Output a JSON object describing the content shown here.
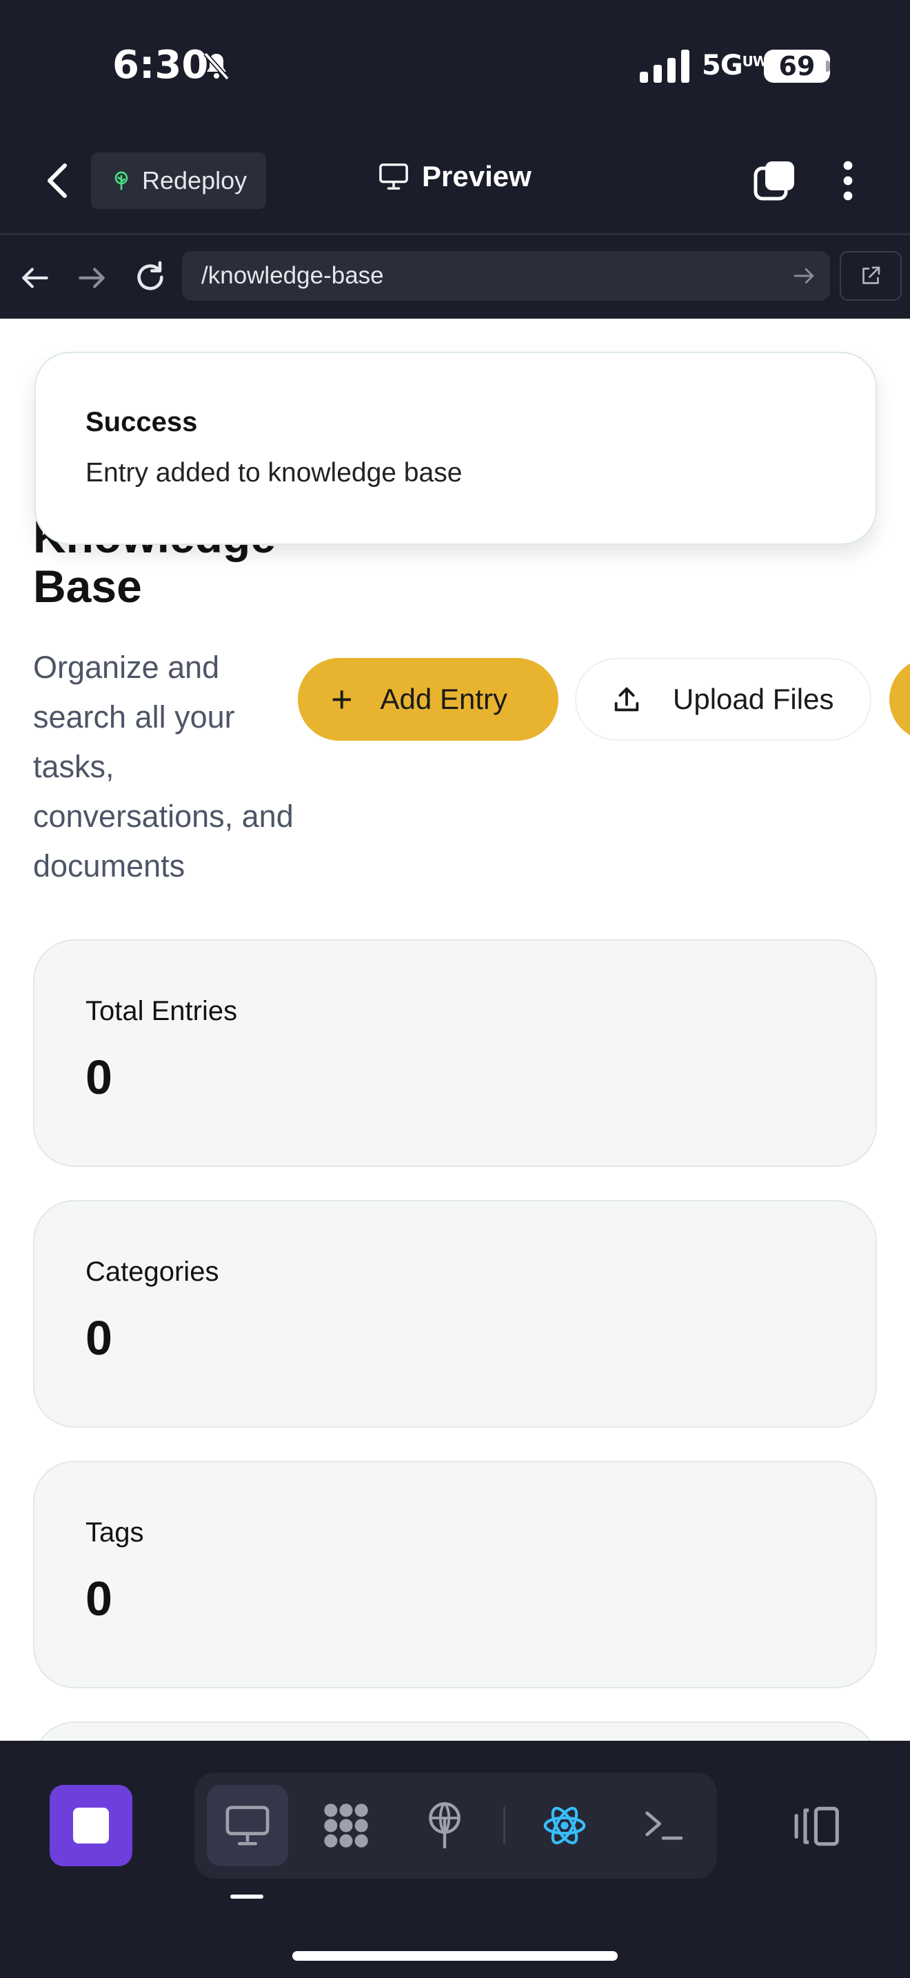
{
  "status_bar": {
    "time": "6:30",
    "network": "5G",
    "network_sup": "UW",
    "battery": "69",
    "icons": [
      "bell-slash-icon",
      "signal-bars-icon"
    ]
  },
  "app_bar": {
    "back_icon": "chevron-left-icon",
    "redeploy_label": "Redeploy",
    "redeploy_icon": "tree-icon",
    "preview_label": "Preview",
    "preview_icon": "monitor-icon",
    "tabs_icon": "tabs-icon",
    "more_icon": "more-vertical-icon"
  },
  "browser": {
    "url": "/knowledge-base",
    "icons": [
      "arrow-left-icon",
      "arrow-right-icon",
      "reload-icon",
      "url-go-arrow-icon",
      "open-external-icon"
    ]
  },
  "toast": {
    "title": "Success",
    "description": "Entry added to knowledge base"
  },
  "page": {
    "title_line1": "Knowledge",
    "title_line2": "Base",
    "subtitle": "Organize and search all your tasks, conversations, and documents",
    "add_entry_label": "Add Entry",
    "add_entry_icon": "+",
    "upload_files_label": "Upload Files",
    "upload_icon": "upload-icon",
    "accent_color": "#E8B32E"
  },
  "stats": [
    {
      "label": "Total Entries",
      "value": "0"
    },
    {
      "label": "Categories",
      "value": "0"
    },
    {
      "label": "Tags",
      "value": "0"
    }
  ],
  "toolbar": {
    "stop_color": "#6D3FDC",
    "tools": [
      "monitor-icon",
      "grid-dots-icon",
      "antenna-icon",
      "react-icon",
      "terminal-icon"
    ],
    "panel_icon": "panel-toggle-icon",
    "react_color": "#38BDF8"
  }
}
